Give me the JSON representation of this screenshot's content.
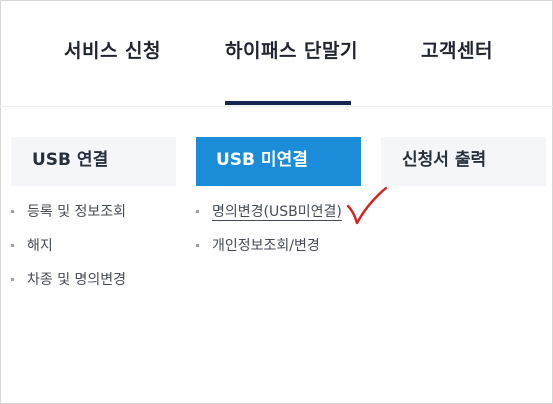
{
  "topnav": {
    "tabs": [
      {
        "label": "서비스 신청"
      },
      {
        "label": "하이패스 단말기"
      },
      {
        "label": "고객센터"
      }
    ],
    "active_index": 1
  },
  "categories": [
    {
      "label": "USB 연결"
    },
    {
      "label": "USB 미연결"
    },
    {
      "label": "신청서 출력"
    }
  ],
  "active_category_index": 1,
  "usb_connected_items": [
    {
      "label": "등록 및 정보조회"
    },
    {
      "label": "해지"
    },
    {
      "label": "차종 및 명의변경"
    }
  ],
  "usb_not_connected_items": [
    {
      "label": "명의변경(USB미연결)"
    },
    {
      "label": "개인정보조회/변경"
    }
  ],
  "colors": {
    "active_category_bg": "#1a8cd8",
    "inactive_category_bg": "#f4f6f9",
    "active_tab_underline": "#162553",
    "check_mark": "#d42222"
  },
  "annotation_icon": "red-check-mark-icon"
}
